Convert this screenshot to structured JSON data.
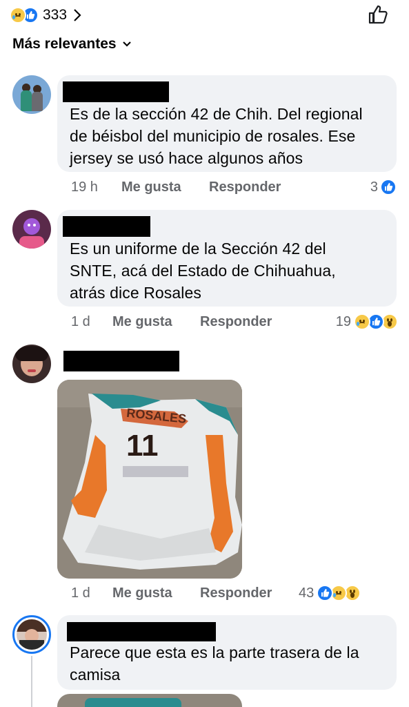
{
  "header": {
    "reaction_count": "333",
    "sort_label": "Más relevantes"
  },
  "comments": [
    {
      "text": "Es de la sección 42 de Chih. Del regional de béisbol del municipio de rosales. Ese jersey se usó hace algunos años",
      "lines": [
        "Es de la sección 42 de Chih. Del regional",
        "de béisbol del municipio de rosales. Ese",
        "jersey se usó hace algunos años"
      ],
      "time": "19 h",
      "like_label": "Me gusta",
      "reply_label": "Responder",
      "reactions": "3"
    },
    {
      "lines": [
        "Es un uniforme de la Sección 42 del",
        "SNTE, acá del Estado de Chihuahua,",
        "atrás dice Rosales"
      ],
      "time": "1 d",
      "like_label": "Me gusta",
      "reply_label": "Responder",
      "reactions": "19"
    },
    {
      "photo_texts": [
        "ROSALES",
        "11"
      ],
      "time": "1 d",
      "like_label": "Me gusta",
      "reply_label": "Responder",
      "reactions": "43"
    },
    {
      "lines": [
        "Parece que esta es la parte trasera de la",
        "camisa"
      ]
    }
  ],
  "colors": {
    "like_blue": "#1877f2",
    "bubble": "#f0f2f5",
    "meta_text": "#65676b"
  }
}
